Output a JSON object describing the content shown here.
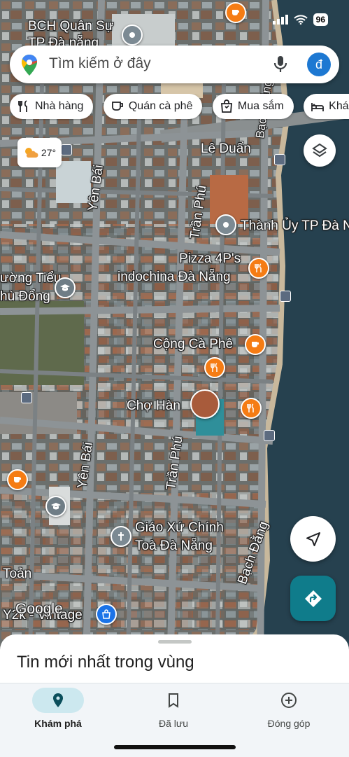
{
  "status_bar": {
    "time": "",
    "battery": "96"
  },
  "search": {
    "placeholder": "Tìm kiếm ở đây",
    "avatar_letter": "đ"
  },
  "chips": [
    {
      "label": "Nhà hàng",
      "icon": "fork-knife-icon"
    },
    {
      "label": "Quán cà phê",
      "icon": "coffee-icon"
    },
    {
      "label": "Mua sắm",
      "icon": "shopping-bag-icon"
    },
    {
      "label": "Khách sạn",
      "icon": "bed-icon"
    }
  ],
  "weather": {
    "temp": "27°",
    "icon": "partly-cloudy-icon"
  },
  "map": {
    "places": {
      "bch_quan_su": "BCH Quân Sự\nTP Đà nẵng",
      "thanh_uy": "Thành Ủy TP Đà Nẵng",
      "pizza": "Pizza 4P's",
      "pizza_line2": "indochina Đà Nẵng",
      "truong_tieu": "ường Tiểu",
      "truong_tieu_line2": "hù Đổng",
      "cong_ca_phe": "Cộng Cà Phê",
      "cho_han": "Chợ Hàn",
      "giao_xu": "Giáo Xứ Chính",
      "giao_xu_line2": "Toà Đà Nẵng",
      "vintage": "Y2k - Vintage",
      "toan": "Toản"
    },
    "streets": {
      "le_duan": "Lê Duẩn",
      "yen_bai_1": "Yên Bái",
      "yen_bai_2": "Yên Bái",
      "tran_phu_1": "Trần Phú",
      "tran_phu_2": "Trần Phú",
      "bach_dang": "Bạch Đằng",
      "bach_dang_top": "Bạch Đằng"
    },
    "attribution": "Google"
  },
  "sheet": {
    "title": "Tin mới nhất trong vùng"
  },
  "bottom_nav": [
    {
      "label": "Khám phá",
      "icon": "explore-pin-icon",
      "active": true
    },
    {
      "label": "Đã lưu",
      "icon": "bookmark-icon",
      "active": false
    },
    {
      "label": "Đóng góp",
      "icon": "add-circle-icon",
      "active": false
    }
  ],
  "colors": {
    "accent": "#1a73e8",
    "directions": "#0f7c8b",
    "poi_orange": "#f57c14",
    "nav_active": "#cce8ef"
  }
}
